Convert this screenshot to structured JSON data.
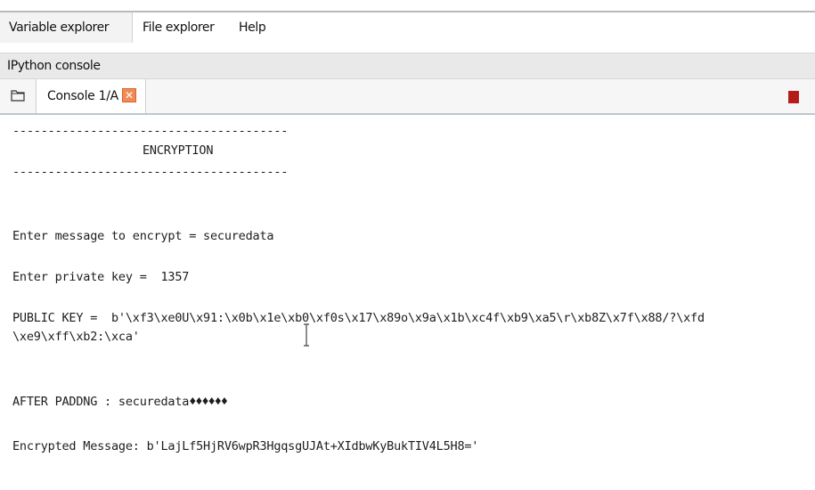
{
  "top_tabs": {
    "variable_explorer": "Variable explorer",
    "file_explorer": "File explorer",
    "help": "Help"
  },
  "pane_title": "IPython console",
  "console_tab": {
    "label": "Console 1/A",
    "close_glyph": "✕"
  },
  "console": {
    "separator_top": "---------------------------------------",
    "heading": "ENCRYPTION",
    "separator_bottom": "---------------------------------------",
    "message_prompt": "Enter message to encrypt = securedata",
    "key_prompt": "Enter private key =  1357",
    "public_key_line1": "PUBLIC KEY =  b'\\xf3\\xe0U\\x91:\\x0b\\x1e\\xb0\\xf0s\\x17\\x89o\\x9a\\x1b\\xc4f\\xb9\\xa5\\r\\xb8Z\\x7f\\x88/?\\xfd",
    "public_key_line2": "\\xe9\\xff\\xb2:\\xca'",
    "padding_label": "AFTER PADDNG : securedata",
    "padding_chars": "♦♦♦♦♦♦",
    "encrypted_line": "Encrypted Message: b'LajLf5HjRV6wpR3HgqsgUJAt+XIdbwKyBukTIV4L5H8='"
  },
  "colors": {
    "stop_button": "#b41c1c",
    "close_tab": "#f08a56"
  }
}
